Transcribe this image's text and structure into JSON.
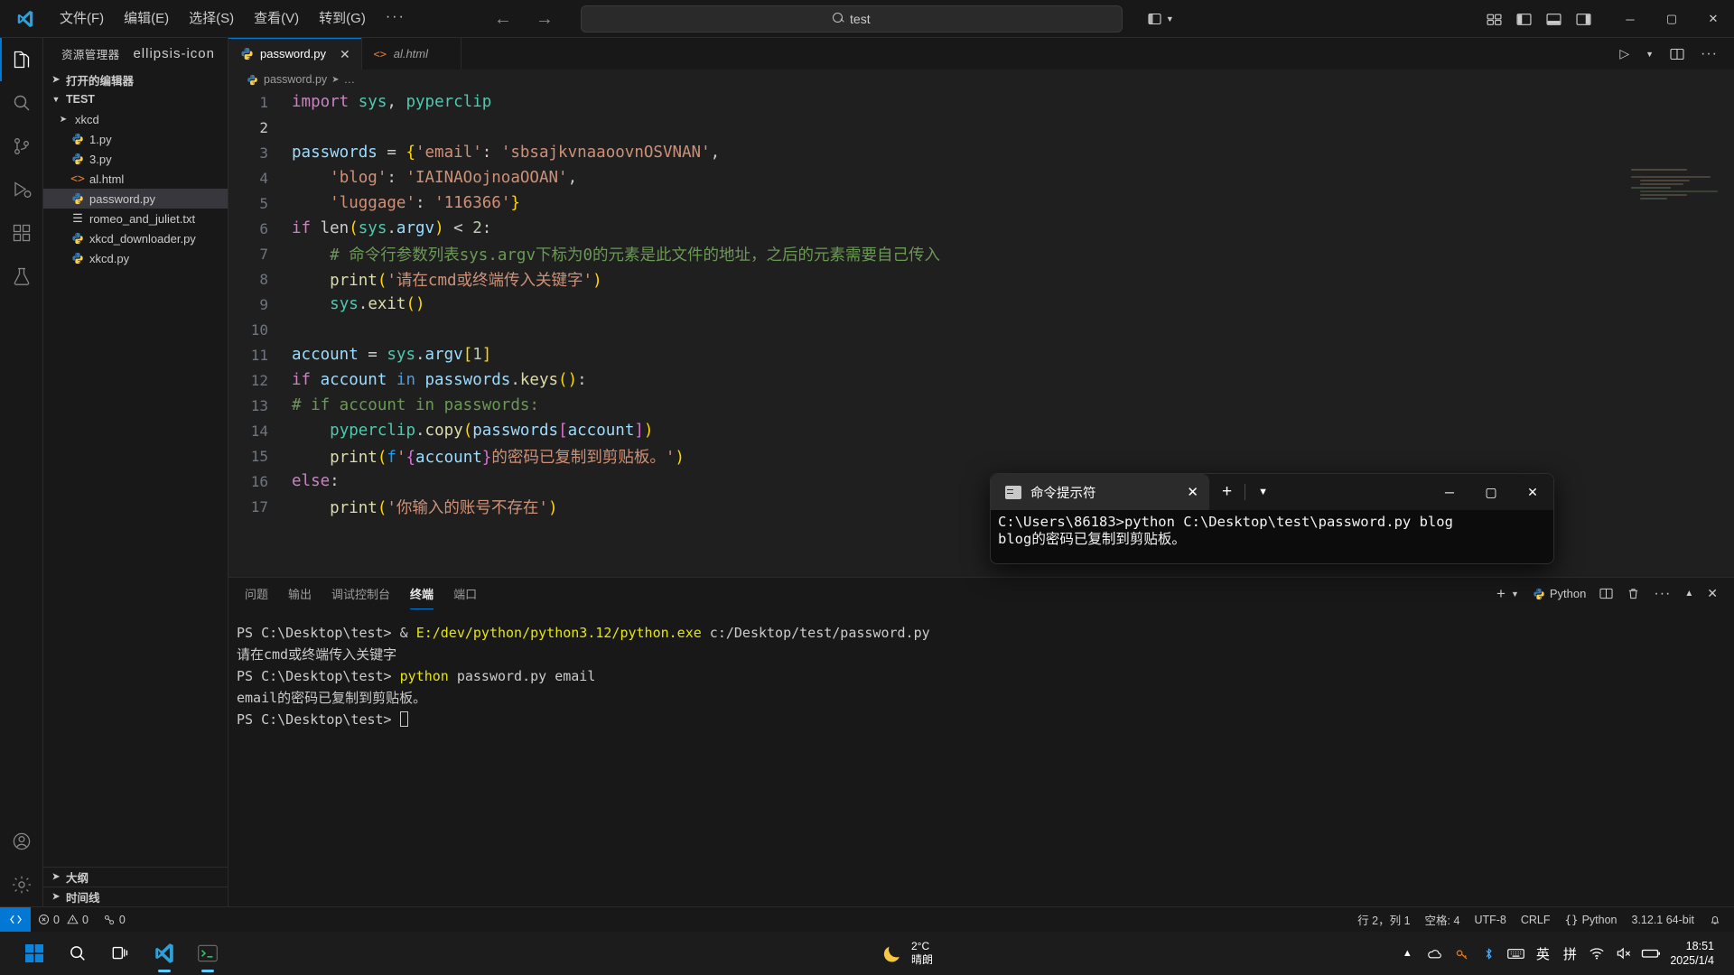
{
  "titlebar": {
    "logo_icon": "vscode-logo-icon",
    "menus": [
      "文件(F)",
      "编辑(E)",
      "选择(S)",
      "查看(V)",
      "转到(G)",
      "···"
    ],
    "nav_back_icon": "arrow-left-icon",
    "nav_forward_icon": "arrow-right-icon",
    "search_value": "test",
    "search_icon": "search-icon",
    "layout_icon": "layout-customize-icon",
    "layout_chevron": "chevron-down-icon",
    "panel_icons": [
      "editor-layout-icon",
      "toggle-primary-sidebar-icon",
      "toggle-panel-icon",
      "toggle-secondary-sidebar-icon"
    ],
    "window_minimize": "─",
    "window_maximize": "▢",
    "window_close": "✕"
  },
  "activitybar": {
    "items": [
      {
        "name": "explorer",
        "icon": "files-icon",
        "active": true
      },
      {
        "name": "search",
        "icon": "search-icon",
        "active": false
      },
      {
        "name": "source-control",
        "icon": "source-control-icon",
        "active": false
      },
      {
        "name": "run-debug",
        "icon": "run-debug-icon",
        "active": false
      },
      {
        "name": "extensions",
        "icon": "extensions-icon",
        "active": false
      },
      {
        "name": "testing",
        "icon": "beaker-icon",
        "active": false
      }
    ],
    "bottom": [
      {
        "name": "accounts",
        "icon": "account-icon"
      },
      {
        "name": "settings",
        "icon": "gear-icon"
      }
    ]
  },
  "sidebar": {
    "title": "资源管理器",
    "more_actions_icon": "ellipsis-icon",
    "open_editors": {
      "label": "打开的编辑器",
      "expanded": false
    },
    "workspace": {
      "label": "TEST",
      "expanded": true
    },
    "files": [
      {
        "label": "xkcd",
        "icon": "folder-chevron-icon",
        "type": "folder",
        "indent": 1,
        "selected": false
      },
      {
        "label": "1.py",
        "icon": "python-icon",
        "type": "file",
        "indent": 1,
        "selected": false
      },
      {
        "label": "3.py",
        "icon": "python-icon",
        "type": "file",
        "indent": 1,
        "selected": false
      },
      {
        "label": "al.html",
        "icon": "html-icon",
        "type": "file",
        "indent": 1,
        "selected": false
      },
      {
        "label": "password.py",
        "icon": "python-icon",
        "type": "file",
        "indent": 1,
        "selected": true
      },
      {
        "label": "romeo_and_juliet.txt",
        "icon": "text-file-icon",
        "type": "file",
        "indent": 1,
        "selected": false
      },
      {
        "label": "xkcd_downloader.py",
        "icon": "python-icon",
        "type": "file",
        "indent": 1,
        "selected": false
      },
      {
        "label": "xkcd.py",
        "icon": "python-icon",
        "type": "file",
        "indent": 1,
        "selected": false
      }
    ],
    "outline": {
      "label": "大纲",
      "expanded": false
    },
    "timeline": {
      "label": "时间线",
      "expanded": false
    }
  },
  "editor": {
    "tabs": [
      {
        "label": "password.py",
        "icon": "python-icon",
        "active": true,
        "italic": false,
        "close_icon": "close-icon"
      },
      {
        "label": "al.html",
        "icon": "html-icon",
        "active": false,
        "italic": true,
        "close_icon": "close-icon"
      }
    ],
    "actions": [
      "run-icon",
      "run-chevron-icon",
      "split-editor-icon",
      "more-actions-icon"
    ],
    "breadcrumb": [
      "password.py",
      "…"
    ],
    "breadcrumb_icon": "python-icon"
  },
  "code": {
    "lines": [
      {
        "n": "1",
        "segments": [
          {
            "t": "import ",
            "c": "k"
          },
          {
            "t": "sys",
            "c": "mod"
          },
          {
            "t": ",",
            "c": "op"
          },
          {
            "t": " pyperclip",
            "c": "mod"
          }
        ]
      },
      {
        "n": "2",
        "segments": []
      },
      {
        "n": "3",
        "segments": [
          {
            "t": "passwords ",
            "c": "var"
          },
          {
            "t": "= ",
            "c": "op"
          },
          {
            "t": "{",
            "c": "p1"
          },
          {
            "t": "'email'",
            "c": "str"
          },
          {
            "t": ": ",
            "c": "op"
          },
          {
            "t": "'sbsajkvnaaoovnOSVNAN'",
            "c": "str"
          },
          {
            "t": ",",
            "c": "op"
          }
        ]
      },
      {
        "n": "4",
        "segments": [
          {
            "t": "    ",
            "c": "op"
          },
          {
            "t": "'blog'",
            "c": "str"
          },
          {
            "t": ": ",
            "c": "op"
          },
          {
            "t": "'IAINAOojnoaOOAN'",
            "c": "str"
          },
          {
            "t": ",",
            "c": "op"
          }
        ]
      },
      {
        "n": "5",
        "segments": [
          {
            "t": "    ",
            "c": "op"
          },
          {
            "t": "'luggage'",
            "c": "str"
          },
          {
            "t": ": ",
            "c": "op"
          },
          {
            "t": "'116366'",
            "c": "str"
          },
          {
            "t": "}",
            "c": "p1"
          }
        ]
      },
      {
        "n": "6",
        "segments": [
          {
            "t": "if ",
            "c": "k"
          },
          {
            "t": "len",
            "c": "op"
          },
          {
            "t": "(",
            "c": "p1"
          },
          {
            "t": "sys",
            "c": "mod"
          },
          {
            "t": ".",
            "c": "op"
          },
          {
            "t": "argv",
            "c": "var"
          },
          {
            "t": ")",
            "c": "p1"
          },
          {
            "t": " < ",
            "c": "op"
          },
          {
            "t": "2",
            "c": "num"
          },
          {
            "t": ":",
            "c": "op"
          }
        ]
      },
      {
        "n": "7",
        "segments": [
          {
            "t": "    # 命令行参数列表sys.argv下标为0的元素是此文件的地址，之后的元素需要自己传入",
            "c": "cm"
          }
        ]
      },
      {
        "n": "8",
        "segments": [
          {
            "t": "    ",
            "c": "op"
          },
          {
            "t": "print",
            "c": "fn"
          },
          {
            "t": "(",
            "c": "p1"
          },
          {
            "t": "'请在cmd或终端传入关键字'",
            "c": "str"
          },
          {
            "t": ")",
            "c": "p1"
          }
        ]
      },
      {
        "n": "9",
        "segments": [
          {
            "t": "    ",
            "c": "op"
          },
          {
            "t": "sys",
            "c": "mod"
          },
          {
            "t": ".",
            "c": "op"
          },
          {
            "t": "exit",
            "c": "fn"
          },
          {
            "t": "(",
            "c": "p1"
          },
          {
            "t": ")",
            "c": "p1"
          }
        ]
      },
      {
        "n": "10",
        "segments": []
      },
      {
        "n": "11",
        "segments": [
          {
            "t": "account ",
            "c": "var"
          },
          {
            "t": "= ",
            "c": "op"
          },
          {
            "t": "sys",
            "c": "mod"
          },
          {
            "t": ".",
            "c": "op"
          },
          {
            "t": "argv",
            "c": "var"
          },
          {
            "t": "[",
            "c": "p1"
          },
          {
            "t": "1",
            "c": "num"
          },
          {
            "t": "]",
            "c": "p1"
          }
        ]
      },
      {
        "n": "12",
        "segments": [
          {
            "t": "if ",
            "c": "k"
          },
          {
            "t": "account ",
            "c": "var"
          },
          {
            "t": "in ",
            "c": "kb"
          },
          {
            "t": "passwords",
            "c": "var"
          },
          {
            "t": ".",
            "c": "op"
          },
          {
            "t": "keys",
            "c": "fn"
          },
          {
            "t": "(",
            "c": "p1"
          },
          {
            "t": ")",
            "c": "p1"
          },
          {
            "t": ":",
            "c": "op"
          }
        ]
      },
      {
        "n": "13",
        "segments": [
          {
            "t": "# if account in passwords:",
            "c": "cm"
          }
        ]
      },
      {
        "n": "14",
        "segments": [
          {
            "t": "    ",
            "c": "op"
          },
          {
            "t": "pyperclip",
            "c": "mod"
          },
          {
            "t": ".",
            "c": "op"
          },
          {
            "t": "copy",
            "c": "fn"
          },
          {
            "t": "(",
            "c": "p1"
          },
          {
            "t": "passwords",
            "c": "var"
          },
          {
            "t": "[",
            "c": "p2"
          },
          {
            "t": "account",
            "c": "var"
          },
          {
            "t": "]",
            "c": "p2"
          },
          {
            "t": ")",
            "c": "p1"
          }
        ]
      },
      {
        "n": "15",
        "segments": [
          {
            "t": "    ",
            "c": "op"
          },
          {
            "t": "print",
            "c": "fn"
          },
          {
            "t": "(",
            "c": "p1"
          },
          {
            "t": "f",
            "c": "p3"
          },
          {
            "t": "'",
            "c": "str"
          },
          {
            "t": "{",
            "c": "p2"
          },
          {
            "t": "account",
            "c": "var"
          },
          {
            "t": "}",
            "c": "p2"
          },
          {
            "t": "的密码已复制到剪贴板。'",
            "c": "str"
          },
          {
            "t": ")",
            "c": "p1"
          }
        ]
      },
      {
        "n": "16",
        "segments": [
          {
            "t": "else",
            "c": "k"
          },
          {
            "t": ":",
            "c": "op"
          }
        ]
      },
      {
        "n": "17",
        "segments": [
          {
            "t": "    ",
            "c": "op"
          },
          {
            "t": "print",
            "c": "fn"
          },
          {
            "t": "(",
            "c": "p1"
          },
          {
            "t": "'你输入的账号不存在'",
            "c": "str"
          },
          {
            "t": ")",
            "c": "p1"
          }
        ]
      }
    ]
  },
  "cmd_window": {
    "tab_title": "命令提示符",
    "tab_icon": "cmd-console-icon",
    "close_tab_icon": "close-icon",
    "new_tab_icon": "plus-icon",
    "dropdown_icon": "chevron-down-icon",
    "minimize": "─",
    "maximize": "▢",
    "close": "✕",
    "lines": [
      "C:\\Users\\86183>python C:\\Desktop\\test\\password.py blog",
      "blog的密码已复制到剪贴板。"
    ]
  },
  "panel": {
    "tabs": [
      {
        "label": "问题",
        "active": false
      },
      {
        "label": "输出",
        "active": false
      },
      {
        "label": "调试控制台",
        "active": false
      },
      {
        "label": "终端",
        "active": true
      },
      {
        "label": "端口",
        "active": false
      }
    ],
    "actions": {
      "new_terminal_icon": "plus-icon",
      "new_terminal_chevron": "chevron-down-icon",
      "profile_icon": "python-terminal-icon",
      "profile_label": "Python",
      "split_icon": "split-terminal-icon",
      "kill_icon": "trash-icon",
      "more_icon": "ellipsis-icon",
      "maximize_icon": "chevron-up-icon",
      "close_icon": "close-icon"
    },
    "terminal_lines": [
      [
        {
          "t": "PS C:\\Desktop\\test> ",
          "c": "t-ps"
        },
        {
          "t": "& ",
          "c": "t-ps"
        },
        {
          "t": "E:/dev/python/python3.12/python.exe ",
          "c": "t-yellow"
        },
        {
          "t": "c:/Desktop/test/password.py",
          "c": "t-ps"
        }
      ],
      [
        {
          "t": "请在cmd或终端传入关键字",
          "c": "t-ps"
        }
      ],
      [
        {
          "t": "PS C:\\Desktop\\test> ",
          "c": "t-ps"
        },
        {
          "t": "python ",
          "c": "t-yellow"
        },
        {
          "t": "password.py email",
          "c": "t-ps"
        }
      ],
      [
        {
          "t": "email的密码已复制到剪贴板。",
          "c": "t-ps"
        }
      ],
      [
        {
          "t": "PS C:\\Desktop\\test> ",
          "c": "t-ps"
        }
      ]
    ]
  },
  "statusbar": {
    "remote_icon": "remote-window-icon",
    "errors_icon": "error-icon",
    "errors": "0",
    "warnings_icon": "warning-icon",
    "warnings": "0",
    "ports_icon": "ports-icon",
    "ports": "0",
    "cursor_position": "行 2，列 1",
    "indentation": "空格: 4",
    "encoding": "UTF-8",
    "eol": "CRLF",
    "language_icon": "braces-icon",
    "language": "Python",
    "interpreter": "3.12.1 64-bit",
    "bell_icon": "bell-icon"
  },
  "taskbar": {
    "start_icon": "windows-start-icon",
    "search_icon": "search-icon",
    "taskview_icon": "task-view-icon",
    "apps": [
      {
        "name": "vscode",
        "icon": "vscode-logo-icon",
        "running": true
      },
      {
        "name": "command-prompt",
        "icon": "cmd-console-icon",
        "running": true
      }
    ],
    "weather": {
      "icon": "moon-icon",
      "temp": "2°C",
      "desc": "晴朗"
    },
    "tray": {
      "overflow_icon": "chevron-up-icon",
      "onedrive_icon": "onedrive-icon",
      "security_icon": "shield-key-icon",
      "bluetooth_icon": "bluetooth-icon",
      "keyboard_icon": "keyboard-icon",
      "ime_lang": "英",
      "ime_mode": "拼",
      "wifi_icon": "wifi-icon",
      "volume_icon": "volume-mute-icon",
      "battery_icon": "battery-icon"
    },
    "clock": {
      "time": "18:51",
      "date": "2025/1/4"
    },
    "notification_icon": "notification-icon"
  }
}
